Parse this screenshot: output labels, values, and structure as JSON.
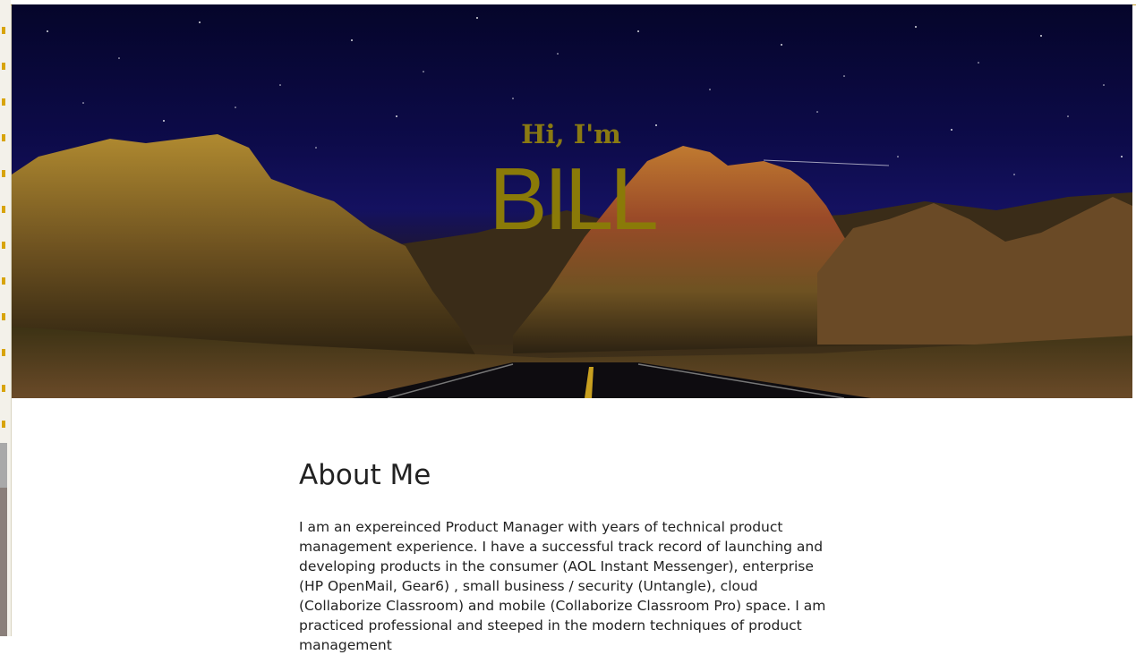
{
  "hero": {
    "greeting": "Hi, I'm",
    "name": "BILL"
  },
  "about": {
    "heading": "About Me",
    "body": "I am an expereinced Product Manager with years of technical product management experience. I have a successful track record of launching and developing products in the consumer (AOL Instant Messenger), enterprise (HP OpenMail, Gear6) , small business / security (Untangle), cloud (Collaborize Classroom) and mobile (Collaborize Classroom Pro) space. I am practiced professional and steeped in the modern techniques of product management"
  },
  "colors": {
    "accent": "#8a7a08",
    "text": "#222222"
  }
}
